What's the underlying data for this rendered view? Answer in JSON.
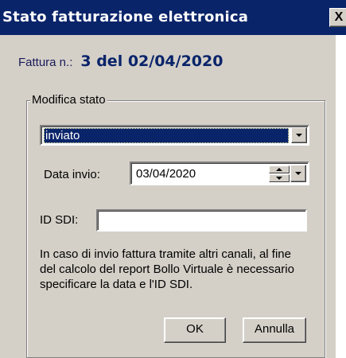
{
  "window": {
    "title": "Stato fatturazione elettronica",
    "close_label": "X"
  },
  "invoice": {
    "label": "Fattura n.:",
    "value": "3 del 02/04/2020"
  },
  "group": {
    "legend": "Modifica stato",
    "status_selected": "inviato",
    "date_label": "Data invio:",
    "date_value": "03/04/2020",
    "sdi_label": "ID SDI:",
    "sdi_value": "",
    "info_text": "In caso di invio fattura tramite altri canali, al fine del calcolo del report Bollo Virtuale è necessario specificare la data e l'ID SDI."
  },
  "buttons": {
    "ok_label": "OK",
    "cancel_label": "Annulla"
  },
  "colors": {
    "titlebar": "#0a246a",
    "face": "#d4d0c8",
    "selection": "#0a246a"
  }
}
